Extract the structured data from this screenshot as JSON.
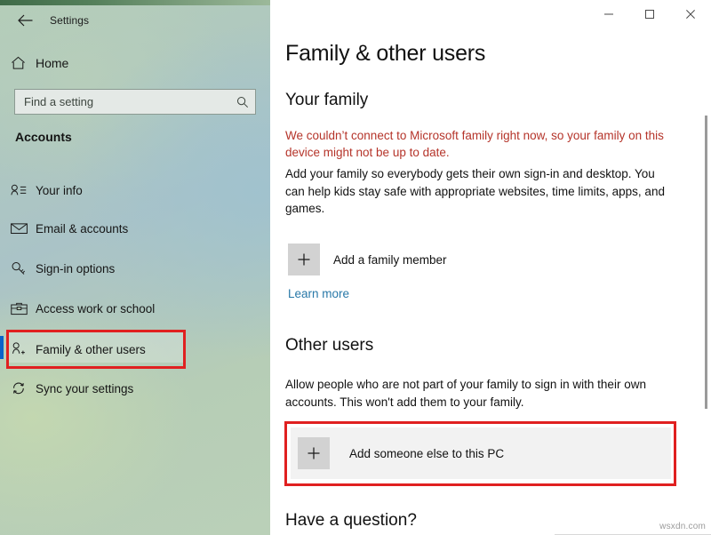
{
  "window": {
    "titlebar": {
      "back_icon": "back-arrow-icon",
      "title": "Settings",
      "minimize_label": "—",
      "maximize_label": "□",
      "close_label": "✕"
    }
  },
  "sidebar": {
    "home": {
      "label": "Home",
      "icon": "home-icon"
    },
    "search": {
      "placeholder": "Find a setting",
      "value": "",
      "icon": "search-icon"
    },
    "category_heading": "Accounts",
    "items": [
      {
        "label": "Your info",
        "icon": "user-info-icon",
        "selected": false
      },
      {
        "label": "Email & accounts",
        "icon": "envelope-icon",
        "selected": false
      },
      {
        "label": "Sign-in options",
        "icon": "key-icon",
        "selected": false
      },
      {
        "label": "Access work or school",
        "icon": "briefcase-icon",
        "selected": false
      },
      {
        "label": "Family & other users",
        "icon": "add-person-icon",
        "selected": true
      },
      {
        "label": "Sync your settings",
        "icon": "sync-icon",
        "selected": false
      }
    ],
    "selected_accent_color": "#0a62c9"
  },
  "main": {
    "page_title": "Family & other users",
    "your_family": {
      "heading": "Your family",
      "warning_text": "We couldn’t connect to Microsoft family right now, so your family on this device might not be up to date.",
      "warning_color": "#b5342a",
      "description": "Add your family so everybody gets their own sign-in and desktop. You can help kids stay safe with appropriate websites, time limits, apps, and games.",
      "add_button_label": "Add a family member",
      "add_button_icon": "plus-icon",
      "learn_more_label": "Learn more",
      "link_color": "#2878a8"
    },
    "other_users": {
      "heading": "Other users",
      "description": "Allow people who are not part of your family to sign in with their own accounts. This won't add them to your family.",
      "add_button_label": "Add someone else to this PC",
      "add_button_icon": "plus-icon"
    },
    "have_question": {
      "heading": "Have a question?"
    }
  },
  "annotations": {
    "highlight_color": "#e02020",
    "boxes": [
      {
        "name": "sidebar-family-other-users-highlight"
      },
      {
        "name": "add-someone-else-highlight"
      }
    ]
  },
  "watermark": {
    "text": "wsxdn.com"
  }
}
